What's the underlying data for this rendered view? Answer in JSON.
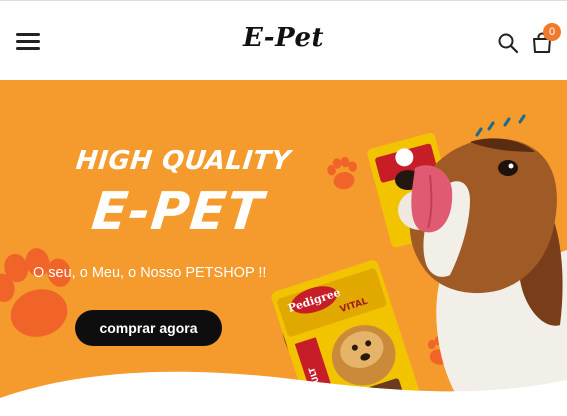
{
  "header": {
    "logo": "E-Pet",
    "cart_count": "0"
  },
  "hero": {
    "headline_small": "HIGH QUALITY",
    "headline_big": "E-PET",
    "tagline": "O seu, o Meu, o Nosso PETSHOP !!",
    "cta_label": "comprar agora",
    "package_brand": "Pedigree",
    "package_variant": "VITAL",
    "package_type": "ADULT"
  },
  "colors": {
    "hero_bg": "#f59a2c",
    "accent": "#f07a2c",
    "paw": "#f0642a",
    "cta_bg": "#0e0e0e"
  },
  "icons": [
    "hamburger-menu-icon",
    "search-icon",
    "shopping-bag-icon",
    "paw-icon"
  ]
}
